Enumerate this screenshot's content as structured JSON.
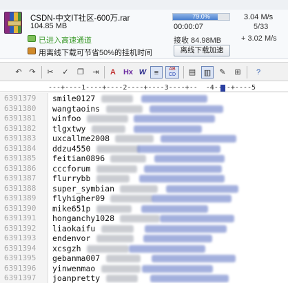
{
  "download": {
    "file_name": "CSDN-中文IT社区-600万.rar",
    "file_size": "104.85 MB",
    "progress_percent": 79.0,
    "progress_label": "79.0%",
    "elapsed_time": "00:00:07",
    "speed": "3.04 M/s",
    "connections": "5/33",
    "received": "接收 84.98MB",
    "boost": "+ 3.02 M/s",
    "high_speed_status": "已进入高速通道",
    "offline_tip": "用离线下载可节省50%的挂机时间",
    "offline_button": "离线下载加速"
  },
  "toolbar": {
    "icons": [
      "undo-icon",
      "redo-icon",
      "cut-icon",
      "spell-check-icon",
      "copy-icon",
      "indent-icon",
      "font-icon",
      "hex-icon",
      "word-wrap-icon",
      "justify-icon",
      "ruler-abcd-icon",
      "view-icon",
      "column-mode-icon",
      "edit-icon",
      "insert-icon",
      "help-icon"
    ],
    "font_glyph": "A",
    "hex_label": "Hx",
    "wrap_glyph": "W",
    "ab_label": "AB",
    "cd_label": "CD"
  },
  "ruler": {
    "text": "---+----1----+----2----+----3----+--  -4----+----5"
  },
  "editor": {
    "rows": [
      {
        "line": "6391379",
        "user": "smile0127"
      },
      {
        "line": "6391380",
        "user": "wangtaoins"
      },
      {
        "line": "6391381",
        "user": "winfoo"
      },
      {
        "line": "6391382",
        "user": "tlgxtwy"
      },
      {
        "line": "6391383",
        "user": "uxcallme2008"
      },
      {
        "line": "6391384",
        "user": "ddzu4550"
      },
      {
        "line": "6391385",
        "user": "feitian0896"
      },
      {
        "line": "6391386",
        "user": "cccforum"
      },
      {
        "line": "6391387",
        "user": "flurrybb"
      },
      {
        "line": "6391388",
        "user": "super_symbian"
      },
      {
        "line": "6391389",
        "user": "flyhigher09"
      },
      {
        "line": "6391390",
        "user": "mike651p"
      },
      {
        "line": "6391391",
        "user": "honganchy1028"
      },
      {
        "line": "6391392",
        "user": "liaokaifu"
      },
      {
        "line": "6391393",
        "user": "endenvor"
      },
      {
        "line": "6391394",
        "user": "xcsgzh"
      },
      {
        "line": "6391395",
        "user": "gebanma007"
      },
      {
        "line": "6391396",
        "user": "yinwenmao"
      },
      {
        "line": "6391397",
        "user": "joanpretty"
      }
    ]
  },
  "colors": {
    "progress_fill": "#4a7fcf",
    "high_speed_green": "#3a9a2a",
    "line_number_gray": "#a6a6a6",
    "blurred_email_blue": "#7d8fd0"
  }
}
